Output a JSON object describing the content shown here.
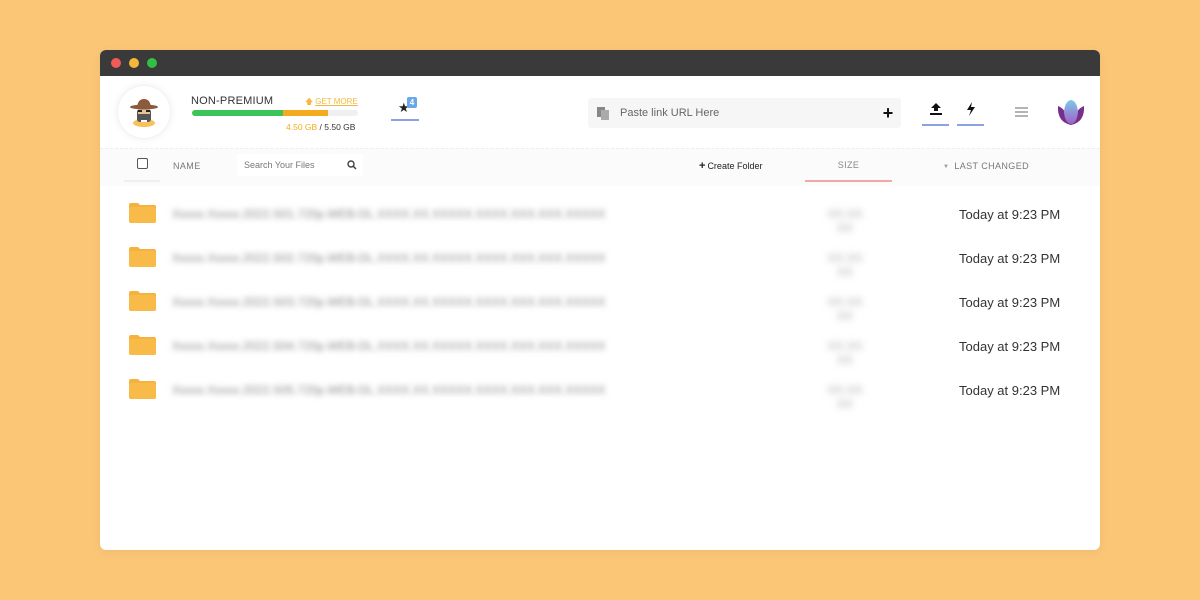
{
  "window": {
    "controls": [
      "close",
      "minimize",
      "maximize"
    ]
  },
  "header": {
    "account": {
      "avatar_icon": "hat-bearded-man-avatar",
      "plan_label": "NON-PREMIUM",
      "get_more_label": "GET MORE",
      "storage_used": "4.50 GB",
      "storage_separator": " / ",
      "storage_total": "5.50 GB",
      "storage_used_fraction": 0.82,
      "storage_green_fraction": 0.55,
      "colors": {
        "green": "#3cc35a",
        "orange": "#f5ab1e",
        "accent": "#f5b93a"
      }
    },
    "favorites": {
      "icon": "star-icon",
      "badge_count": "4"
    },
    "url_input": {
      "placeholder": "Paste link URL Here",
      "value": "",
      "add_label": "+"
    },
    "tools": [
      {
        "name": "upload",
        "icon": "upload-icon"
      },
      {
        "name": "quick",
        "icon": "bolt-icon"
      }
    ],
    "menu_icon": "hamburger-icon",
    "profile_logo": "lotus-logo"
  },
  "table": {
    "columns": {
      "name": "NAME",
      "search_placeholder": "Search Your Files",
      "create_folder": "Create Folder",
      "size": "SIZE",
      "last_changed": "LAST CHANGED"
    },
    "rows": [
      {
        "type": "folder",
        "name": "Xxxxx.Xxxxx.2022.S01.720p.WEB-DL.XXXX.XX.XXXXX.XXXX.XXX.XXX.XXXXX",
        "size": "XX.XX XX",
        "changed": "Today at 9:23 PM"
      },
      {
        "type": "folder",
        "name": "Xxxxx.Xxxxx.2022.S02.720p.WEB-DL.XXXX.XX.XXXXX.XXXX.XXX.XXX.XXXXX",
        "size": "XX.XX XX",
        "changed": "Today at 9:23 PM"
      },
      {
        "type": "folder",
        "name": "Xxxxx.Xxxxx.2022.S03.720p.WEB-DL.XXXX.XX.XXXXX.XXXX.XXX.XXX.XXXXX",
        "size": "XX.XX XX",
        "changed": "Today at 9:23 PM"
      },
      {
        "type": "folder",
        "name": "Xxxxx.Xxxxx.2022.S04.720p.WEB-DL.XXXX.XX.XXXXX.XXXX.XXX.XXX.XXXXX",
        "size": "XX.XX XX",
        "changed": "Today at 9:23 PM"
      },
      {
        "type": "folder",
        "name": "Xxxxx.Xxxxx.2022.S05.720p.WEB-DL.XXXX.XX.XXXXX.XXXX.XXX.XXX.XXXXX",
        "size": "XX.XX XX",
        "changed": "Today at 9:23 PM"
      }
    ]
  }
}
